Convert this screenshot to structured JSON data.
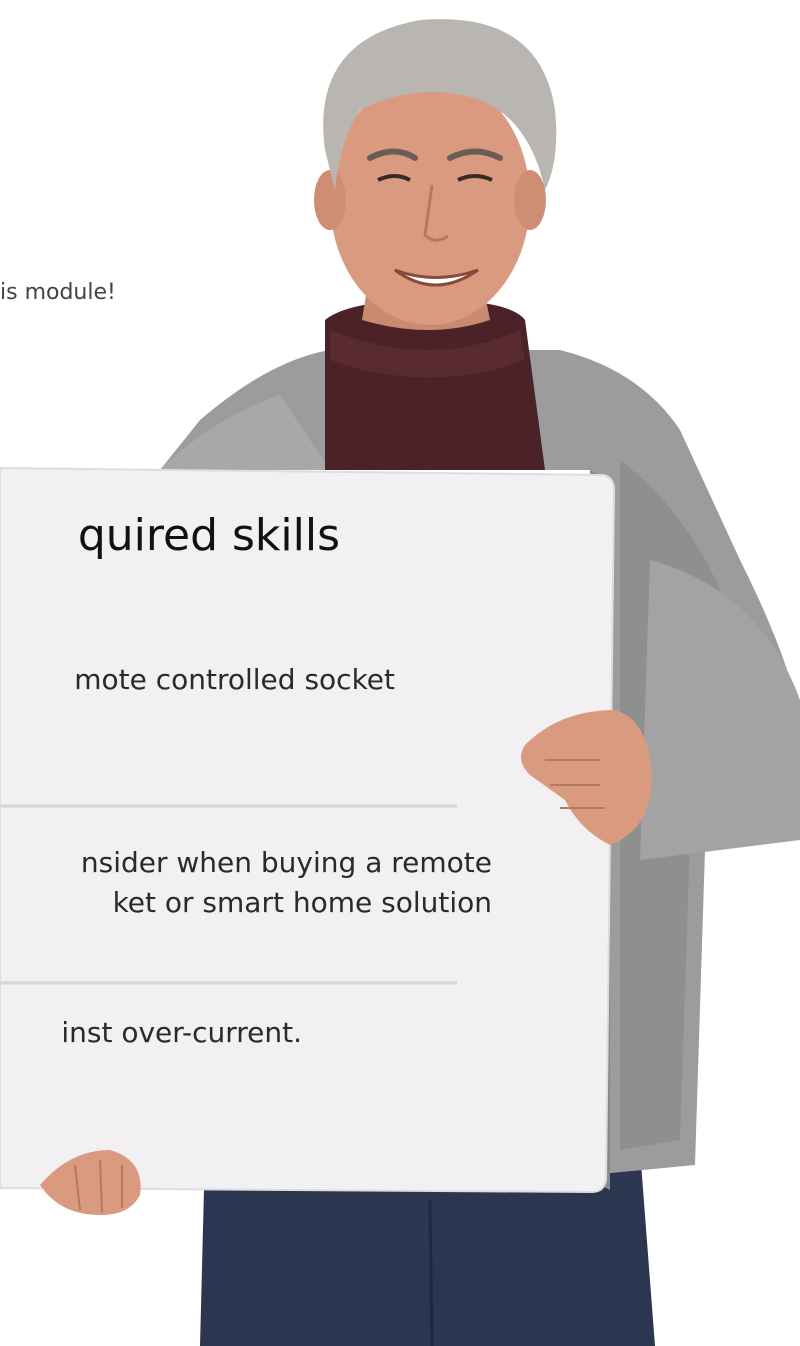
{
  "caption": "is module!",
  "board": {
    "heading": "quired skills",
    "items": [
      {
        "lines": [
          "mote controlled socket"
        ]
      },
      {
        "lines": [
          "nsider when buying a remote",
          "ket or smart home solution"
        ]
      },
      {
        "lines": [
          "inst over-current."
        ]
      }
    ]
  },
  "colors": {
    "board": "#f2f0f2",
    "divider": "#d6d6d6",
    "jacket": "#9a9a9a",
    "turtleneck": "#4a2228",
    "trousers": "#2b3650",
    "skin": "#d99a80",
    "hair": "#b9b6b2"
  }
}
